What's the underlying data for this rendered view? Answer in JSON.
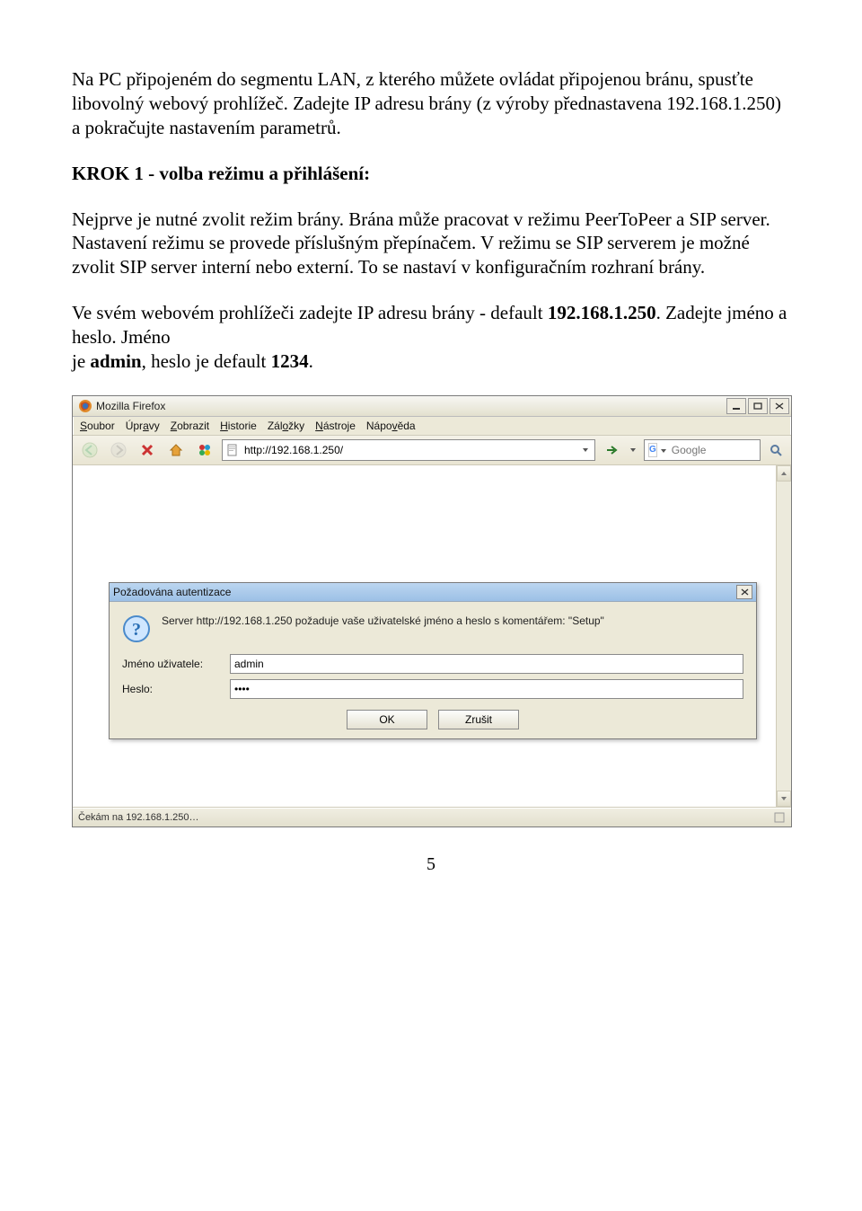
{
  "doc": {
    "p1": "Na PC připojeném do segmentu LAN, z kterého můžete ovládat připojenou bránu, spusťte libovolný webový prohlížeč. Zadejte IP adresu brány (z výroby přednastavena 192.168.1.250) a pokračujte nastavením parametrů.",
    "h1": "KROK 1 - volba režimu a přihlášení:",
    "p2": "Nejprve je nutné zvolit režim brány. Brána může pracovat v režimu PeerToPeer a SIP server. Nastavení režimu se provede příslušným přepínačem. V režimu se SIP serverem je možné zvolit SIP server interní nebo externí. To se nastaví v konfiguračním rozhraní brány.",
    "p3a": "Ve svém webovém prohlížeči zadejte IP adresu brány - default ",
    "p3b": "192.168.1.250",
    "p3c": ". Zadejte jméno a heslo. Jméno",
    "p3d": "je ",
    "p3e": "admin",
    "p3f": ", heslo je default ",
    "p3g": "1234",
    "p3h": ".",
    "pagenum": "5"
  },
  "browser": {
    "title": "Mozilla Firefox",
    "menu": {
      "soubor": "Soubor",
      "upravy": "Úpravy",
      "zobrazit": "Zobrazit",
      "historie": "Historie",
      "zalozky": "Záložky",
      "nastroje": "Nástroje",
      "napoveda": "Nápověda"
    },
    "url": "http://192.168.1.250/",
    "search_placeholder": "Google",
    "status": "Čekám na 192.168.1.250…"
  },
  "dialog": {
    "title": "Požadována autentizace",
    "message": "Server http://192.168.1.250 požaduje vaše uživatelské jméno a heslo s komentářem: \"Setup\"",
    "user_label": "Jméno uživatele:",
    "user_value": "admin",
    "pass_label": "Heslo:",
    "pass_value": "••••",
    "ok": "OK",
    "cancel": "Zrušit"
  }
}
